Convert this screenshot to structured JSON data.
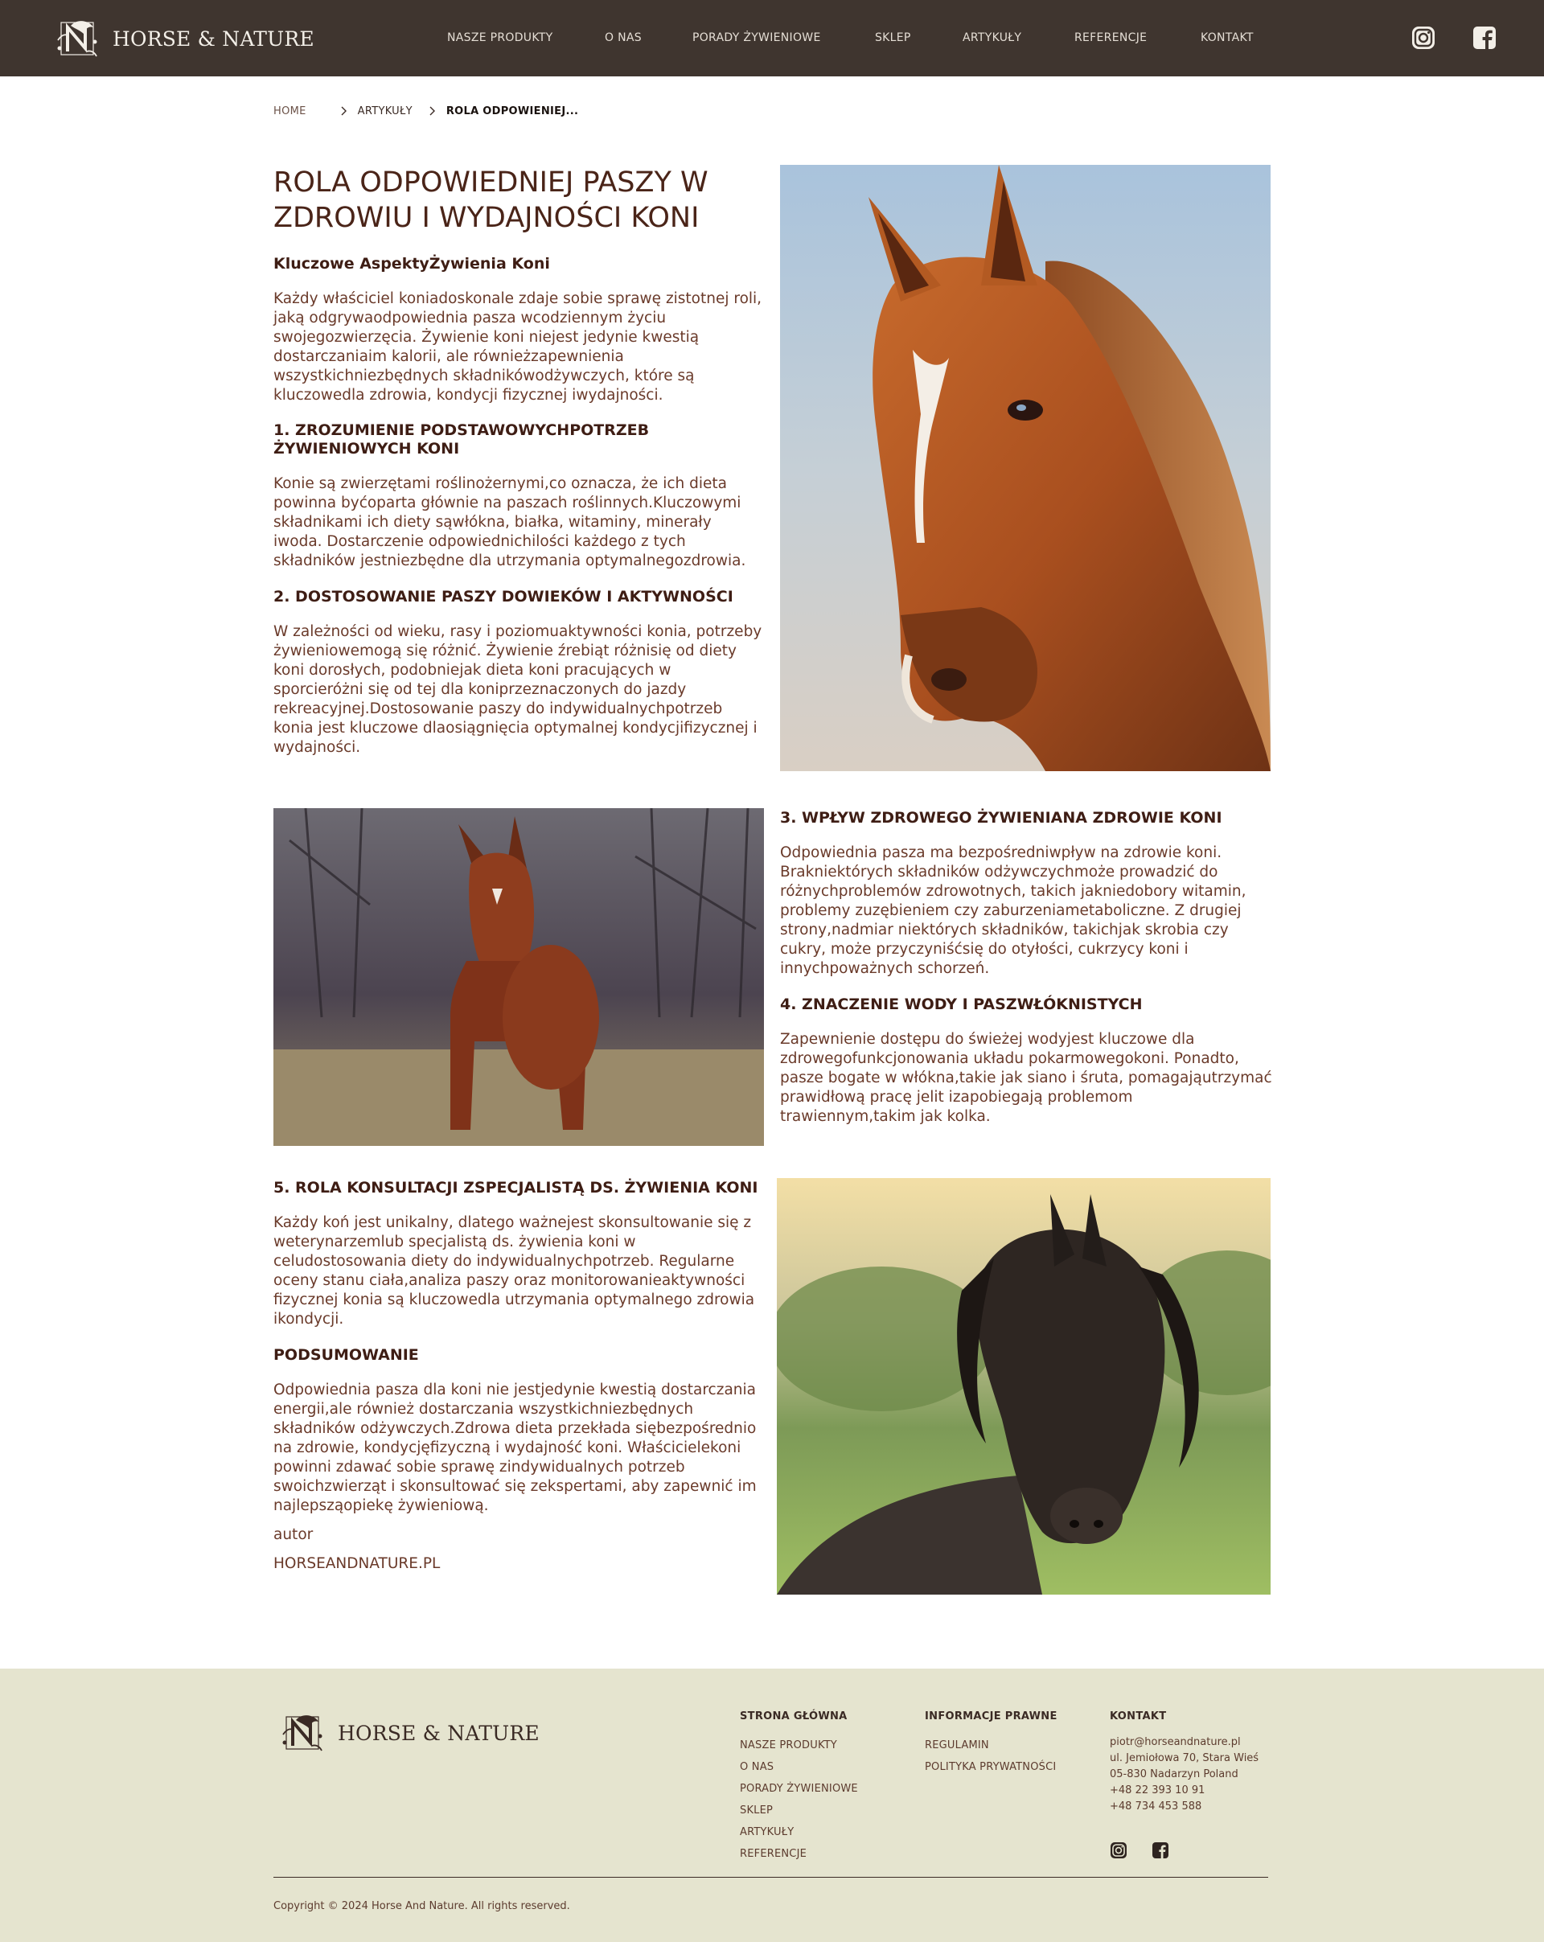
{
  "header": {
    "logo_text": "HORSE & NATURE",
    "nav": [
      {
        "label": "NASZE PRODUKTY"
      },
      {
        "label": "O NAS"
      },
      {
        "label": "PORADY ŻYWIENIOWE"
      },
      {
        "label": "SKLEP"
      },
      {
        "label": "ARTYKUŁY"
      },
      {
        "label": "REFERENCJE"
      },
      {
        "label": "KONTAKT"
      }
    ],
    "social": [
      "instagram-icon",
      "facebook-icon"
    ]
  },
  "breadcrumb": {
    "home": "HOME",
    "section": "ARTYKUŁY",
    "current": "ROLA ODPOWIENIEJ..."
  },
  "article": {
    "title_line1": "ROLA ODPOWIEDNIEJ PASZY W",
    "title_line2": "ZDROWIU I WYDAJNOŚCI KONI",
    "intro_heading": "Kluczowe AspektyŻywienia Koni",
    "intro_text": "Każdy właściciel koniadoskonale zdaje sobie sprawę zistotnej roli, jaką odgrywaodpowiednia pasza wcodziennym życiu swojegozwierzęcia. Żywienie koni niejest jedynie kwestią dostarczaniaim kalorii, ale równieżzapewnienia wszystkichniezbędnych składnikówodżywczych, które są kluczowedla zdrowia, kondycji fizycznej iwydajności.",
    "s1_heading_l1": "1. ZROZUMIENIE PODSTAWOWYCHPOTRZEB",
    "s1_heading_l2": "ŻYWIENIOWYCH KONI",
    "s1_text": "Konie są zwierzętami roślinożernymi,co oznacza, że ich dieta powinna byćoparta głównie na paszach roślinnych.Kluczowymi składnikami ich diety sąwłókna, białka, witaminy, minerały iwoda. Dostarczenie odpowiednichilości każdego z tych składników jestniezbędne dla utrzymania optymalnegozdrowia.",
    "s2_heading": "2. DOSTOSOWANIE PASZY DOWIEKÓW I AKTYWNOŚCI",
    "s2_text": "W zależności od wieku, rasy i poziomuaktywności konia, potrzeby żywieniowemogą się różnić. Żywienie źrebiąt różnisię od diety koni dorosłych, podobniejak dieta koni pracujących w sporcieróżni się od tej dla koniprzeznaczonych do jazdy rekreacyjnej.Dostosowanie paszy do indywidualnychpotrzeb konia jest kluczowe dlaosiągnięcia optymalnej kondycjifizycznej i wydajności.",
    "s3_heading": "3. WPŁYW ZDROWEGO ŻYWIENIANA ZDROWIE KONI",
    "s3_text": "Odpowiednia pasza ma bezpośredniwpływ na zdrowie koni. Brakniektórych składników odżywczychmoże prowadzić do różnychproblemów zdrowotnych, takich jakniedobory witamin, problemy zuzębieniem czy zaburzeniametaboliczne. Z drugiej strony,nadmiar niektórych składników, takichjak skrobia czy cukry, może przyczyniśćsię do otyłości, cukrzycy koni i innychpoważnych schorzeń.",
    "s4_heading": "4. ZNACZENIE WODY I PASZWŁÓKNISTYCH",
    "s4_text": "Zapewnienie dostępu do świeżej wodyjest kluczowe dla zdrowegofunkcjonowania układu pokarmowegokoni. Ponadto, pasze bogate w włókna,takie jak siano i śruta, pomagająutrzymać prawidłową pracę jelit izapobiegają problemom trawiennym,takim jak kolka.",
    "s5_heading": "5. ROLA KONSULTACJI ZSPECJALISTĄ DS. ŻYWIENIA KONI",
    "s5_text": "Każdy koń jest unikalny, dlatego ważnejest skonsultowanie się z weterynarzemlub specjalistą ds. żywienia koni w celudostosowania diety do indywidualnychpotrzeb. Regularne oceny stanu ciała,analiza paszy oraz monitorowanieaktywności fizycznej konia są kluczowedla utrzymania optymalnego zdrowia ikondycji.",
    "summary_heading": "PODSUMOWANIE",
    "summary_text": "Odpowiednia pasza dla koni nie jestjedynie kwestią dostarczania energii,ale również dostarczania wszystkichniezbędnych składników odżywczych.Zdrowa dieta przekłada siębezpośrednio na zdrowie, kondycjęfizyczną i wydajność koni. Właścicielekoni powinni zdawać sobie sprawę zindywidualnych potrzeb swoichzwierząt i skonsultować się zekspertami, aby zapewnić im najlepsząopiekę żywieniową.",
    "author_label": "autor",
    "author_name": "HORSEANDNATURE.PL"
  },
  "footer": {
    "logo_text": "HORSE & NATURE",
    "col1": {
      "heading": "STRONA GŁÓWNA",
      "links": [
        "NASZE PRODUKTY",
        "O NAS",
        "PORADY ŻYWIENIOWE",
        "SKLEP",
        "ARTYKUŁY",
        "REFERENCJE"
      ]
    },
    "col2": {
      "heading": "INFORMACJE PRAWNE",
      "links": [
        "REGULAMIN",
        "POLITYKA PRYWATNOŚCI"
      ]
    },
    "col3": {
      "heading": "KONTAKT",
      "email": "piotr@horseandnature.pl",
      "address1": "ul. Jemiołowa 70, Stara Wieś",
      "address2": "05-830 Nadarzyn Poland",
      "phone1": "+48 22 393 10 91",
      "phone2": "+48 734 453 588"
    },
    "copyright": "Copyright © 2024 Horse And Nature. All rights reserved."
  },
  "colors": {
    "header_bg": "#3f352f",
    "footer_bg": "#e5e4cf",
    "text_brown": "#5a3426"
  }
}
